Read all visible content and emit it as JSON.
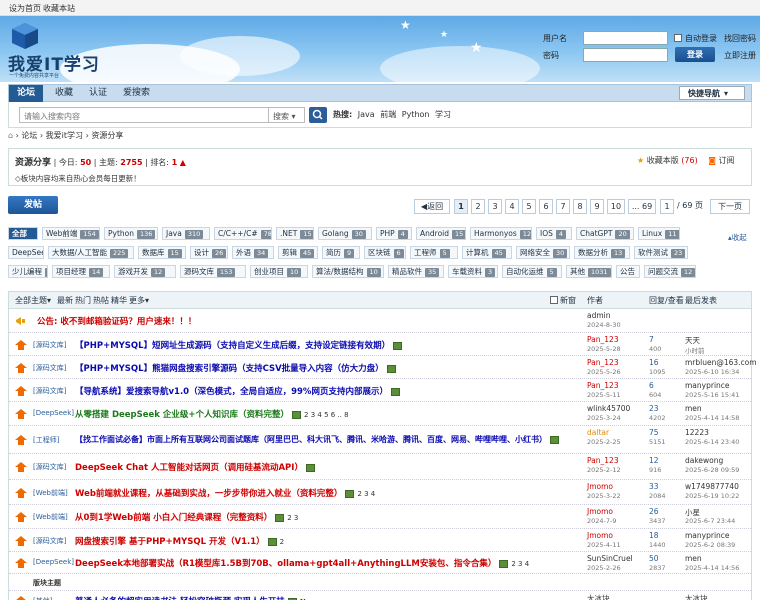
{
  "topbar": {
    "set_home": "设为首页",
    "bookmark": "收藏本站"
  },
  "logo": {
    "title": "我爱IT学习",
    "subtitle": "一个免费内容共享平台"
  },
  "login": {
    "username_label": "用户名",
    "password_label": "密码",
    "auto_login": "自动登录",
    "forgot": "找回密码",
    "login_btn": "登录",
    "register": "立即注册"
  },
  "nav": {
    "tabs": [
      "论坛",
      "收藏",
      "认证",
      "爱搜索"
    ],
    "quick": "快捷导航"
  },
  "search": {
    "placeholder": "请输入搜索内容",
    "type": "搜索",
    "hot_label": "热搜:",
    "hot": [
      "Java",
      "前端",
      "Python",
      "学习"
    ]
  },
  "breadcrumb": [
    "论坛",
    "我爱it学习",
    "资源分享"
  ],
  "forum": {
    "name": "资源分享",
    "today_label": "今日:",
    "today": "50",
    "topics_label": "主题:",
    "topics": "2755",
    "rank_label": "排名:",
    "rank": "1",
    "desc": "◇板块内容均来自热心会员每日更新！",
    "fav_label": "收藏本版",
    "fav_count": "(76)",
    "subscribe": "订阅"
  },
  "actions": {
    "post": "发帖",
    "back": "返回",
    "pages": [
      "1",
      "2",
      "3",
      "4",
      "5",
      "6",
      "7",
      "8",
      "9",
      "10",
      "... 69"
    ],
    "page_input": "1",
    "page_total": "/ 69 页",
    "next": "下一页"
  },
  "categories": [
    {
      "name": "全部",
      "count": ""
    },
    {
      "name": "Web前端",
      "count": "154"
    },
    {
      "name": "Python",
      "count": "136"
    },
    {
      "name": "Java",
      "count": "310"
    },
    {
      "name": "C/C++/C#",
      "count": "78"
    },
    {
      "name": ".NET",
      "count": "15"
    },
    {
      "name": "Golang",
      "count": "30"
    },
    {
      "name": "PHP",
      "count": "4"
    },
    {
      "name": "Android",
      "count": "15"
    },
    {
      "name": "Harmonyos",
      "count": "12"
    },
    {
      "name": "IOS",
      "count": "4"
    },
    {
      "name": "ChatGPT",
      "count": "20"
    },
    {
      "name": "Linux",
      "count": "11"
    },
    {
      "name": "DeepSeek",
      "count": "4"
    },
    {
      "name": "大数据/人工智能",
      "count": "225"
    },
    {
      "name": "数据库",
      "count": "15"
    },
    {
      "name": "设计",
      "count": "26"
    },
    {
      "name": "外语",
      "count": "34"
    },
    {
      "name": "剪辑",
      "count": "45"
    },
    {
      "name": "简历",
      "count": "9"
    },
    {
      "name": "区块链",
      "count": "6"
    },
    {
      "name": "工程师",
      "count": "5"
    },
    {
      "name": "计算机",
      "count": "45"
    },
    {
      "name": "网络安全",
      "count": "30"
    },
    {
      "name": "数据分析",
      "count": "13"
    },
    {
      "name": "软件测试",
      "count": "23"
    },
    {
      "name": "少儿编程",
      "count": "14"
    },
    {
      "name": "项目经理",
      "count": "14"
    },
    {
      "name": "游戏开发",
      "count": "12"
    },
    {
      "name": "源码文库",
      "count": "153"
    },
    {
      "name": "创业项目",
      "count": "10"
    },
    {
      "name": "算法/数据结构",
      "count": "10"
    },
    {
      "name": "精品软件",
      "count": "35"
    },
    {
      "name": "车载资料",
      "count": "3"
    },
    {
      "name": "自动化运维",
      "count": "5"
    },
    {
      "name": "其他",
      "count": "1031"
    },
    {
      "name": "公告",
      "count": ""
    },
    {
      "name": "问题交流",
      "count": "12"
    }
  ],
  "collapse": "收起",
  "list_header": {
    "all": "全部主题",
    "latest": "最新",
    "hot": "热门",
    "hotpost": "热帖",
    "digest": "精华",
    "more": "更多",
    "new": "新窗",
    "author": "作者",
    "replies": "回复/查看",
    "last": "最后发表"
  },
  "threads": [
    {
      "type": "",
      "title": "公告: 收不到邮箱验证码？用户速来！！！",
      "color": "#c00",
      "author": "admin",
      "date": "2024-8-30",
      "replies": "",
      "views": "",
      "last": "",
      "last_date": ""
    },
    {
      "type": "[源码文库]",
      "title": "【PHP+MYSQL】短网址生成源码（支持自定义生成后缀，支持设定链接有效期）",
      "color": "#0a0ab0",
      "author": "Pan_123",
      "date": "2025-5-28",
      "replies": "7",
      "views": "400",
      "last": "天天",
      "last_date": "小时前"
    },
    {
      "type": "[源码文库]",
      "title": "【PHP+MYSQL】熊猫网盘搜索引擎源码（支持CSV批量导入内容（仿大力盘）",
      "color": "#0a0ab0",
      "author": "Pan_123",
      "date": "2025-5-26",
      "replies": "16",
      "views": "1095",
      "last": "mrbluen@163.com",
      "last_date": "2025-6-10 16:34"
    },
    {
      "type": "[源码文库]",
      "title": "【导航系统】爱搜索导航v1.0（深色模式，全局自适应，99%网页支持内部展示）",
      "color": "#0a0ab0",
      "author": "Pan_123",
      "date": "2025-5-11",
      "replies": "6",
      "views": "604",
      "last": "manyprince",
      "last_date": "2025-5-16 15:41"
    },
    {
      "type": "[DeepSeek]",
      "title": "从零搭建 DeepSeek 企业级+个人知识库（资料完整）",
      "color": "#1a7a1a",
      "author": "wlink45700",
      "date": "2025-3-24",
      "replies": "23",
      "views": "4202",
      "last": "men",
      "last_date": "2025-4-14 14:58",
      "pages": "2 3 4 5 6 .. 8"
    },
    {
      "type": "[工程师]",
      "title": "【找工作面试必备】市面上所有互联网公司面试题库（阿里巴巴、科大讯飞、腾讯、米哈游、腾讯、百度、网易、哔哩哔哩、小红书）",
      "color": "#0a0ab0",
      "author": "daltar",
      "date": "2025-2-25",
      "replies": "75",
      "views": "5151",
      "last": "12223",
      "last_date": "2025-6-14 23:40"
    },
    {
      "type": "[源码文库]",
      "title": "DeepSeek Chat 人工智能对话网页（调用硅基流动API）",
      "color": "#c00",
      "author": "Pan_123",
      "date": "2025-2-12",
      "replies": "12",
      "views": "916",
      "last": "dakewong",
      "last_date": "2025-6-28 09:59"
    },
    {
      "type": "[Web前端]",
      "title": "Web前端就业课程，从基础到实战，一步步带你进入就业（资料完整）",
      "color": "#c00",
      "author": "Jmomo",
      "date": "2025-3-22",
      "replies": "33",
      "views": "2084",
      "last": "w1749877740",
      "last_date": "2025-6-19 10:22",
      "pages": "2 3 4"
    },
    {
      "type": "[Web前端]",
      "title": "从0到1学Web前端 小白入门经典课程（完整资料）",
      "color": "#c00",
      "author": "Jmomo",
      "date": "2024-7-9",
      "replies": "26",
      "views": "3437",
      "last": "小星",
      "last_date": "2025-6-7 23:44",
      "pages": "2 3"
    },
    {
      "type": "[源码文库]",
      "title": "网盘搜索引擎 基于PHP+MYSQL 开发（V1.1）",
      "color": "#c00",
      "author": "Jmomo",
      "date": "2025-4-11",
      "replies": "18",
      "views": "1440",
      "last": "manyprince",
      "last_date": "2025-6-2 08:39",
      "pages": "2"
    },
    {
      "type": "[DeepSeek]",
      "title": "DeepSeek本地部署实战（R1模型库1.5B到70B、ollama+gpt4all+AnythingLLM安装包、指令合集）",
      "color": "#c00",
      "author": "SunSinCruel",
      "date": "2025-2-26",
      "replies": "50",
      "views": "2837",
      "last": "men",
      "last_date": "2025-4-14 14:56",
      "pages": "2 3 4"
    },
    {
      "type": "版块主题",
      "title": "",
      "color": "#333",
      "author": "",
      "date": "",
      "replies": "",
      "views": "",
      "last": "",
      "last_date": ""
    },
    {
      "type": "[其他]",
      "title": "普通人必备的超实用读书法 轻松突破瓶颈 实现人生开挂",
      "color": "#0a0ab0",
      "author": "大冰块",
      "date": "",
      "replies": "",
      "views": "",
      "last": "大冰块",
      "last_date": ""
    }
  ],
  "new_tag": "New",
  "colors": {
    "accent": "#245b94",
    "red": "#cc0000",
    "blue": "#0a0ab0",
    "green": "#1a7a1a"
  }
}
